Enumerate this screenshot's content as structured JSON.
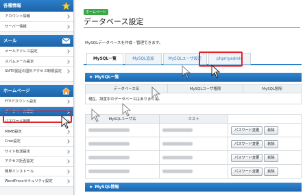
{
  "sidebar": {
    "sections": [
      {
        "title": "各種情報",
        "icon": "star-icon",
        "items": [
          "アカウント情報",
          "サーバー情報"
        ]
      },
      {
        "title": "メール",
        "icon": "mail-icon",
        "items": [
          "メールアドレス設定",
          "スパムメール設定",
          "SMTP認証の国外アクセス制限設定"
        ]
      },
      {
        "title": "ホームページ",
        "icon": "home-icon",
        "items": [
          "FTPアカウント設定",
          "データベース設定",
          "パスワード制限",
          "MIME設定",
          "Cron設定",
          "サイト転送設定",
          "アクセス拒否設定",
          "簡単インストール",
          "WordPressセキュリティ設定"
        ]
      }
    ],
    "active_item": "データベース設定"
  },
  "main": {
    "badge": "ホームページ",
    "title": "データベース設定",
    "description": "MySQLデータベースを作成・管理できます。",
    "tabs": [
      "MySQL一覧",
      "MySQL追加",
      "MySQLユーザ設定",
      "phpmyadmin"
    ],
    "selected_tab": "MySQL一覧",
    "section1": {
      "heading": "MySQL一覧",
      "columns": [
        "データベース名",
        "MySQLユーザ権限",
        "MySQL削除"
      ],
      "empty_message": "現在、設置中のデータベースはありません。"
    },
    "section2": {
      "columns": [
        "MySQLユーザ名",
        "ホスト"
      ],
      "rows": [
        {
          "change": "パスワード変更",
          "delete": "削除"
        },
        {
          "change": "パスワード変更",
          "delete": "削除"
        },
        {
          "change": "パスワード変更",
          "delete": "削除"
        },
        {
          "change": "パスワード変更",
          "delete": "削除"
        }
      ]
    },
    "section3": {
      "heading": "MySQL情報"
    }
  },
  "colors": {
    "accent": "#2b7ec9",
    "highlight": "#e0242a",
    "badge": "#39a843"
  }
}
